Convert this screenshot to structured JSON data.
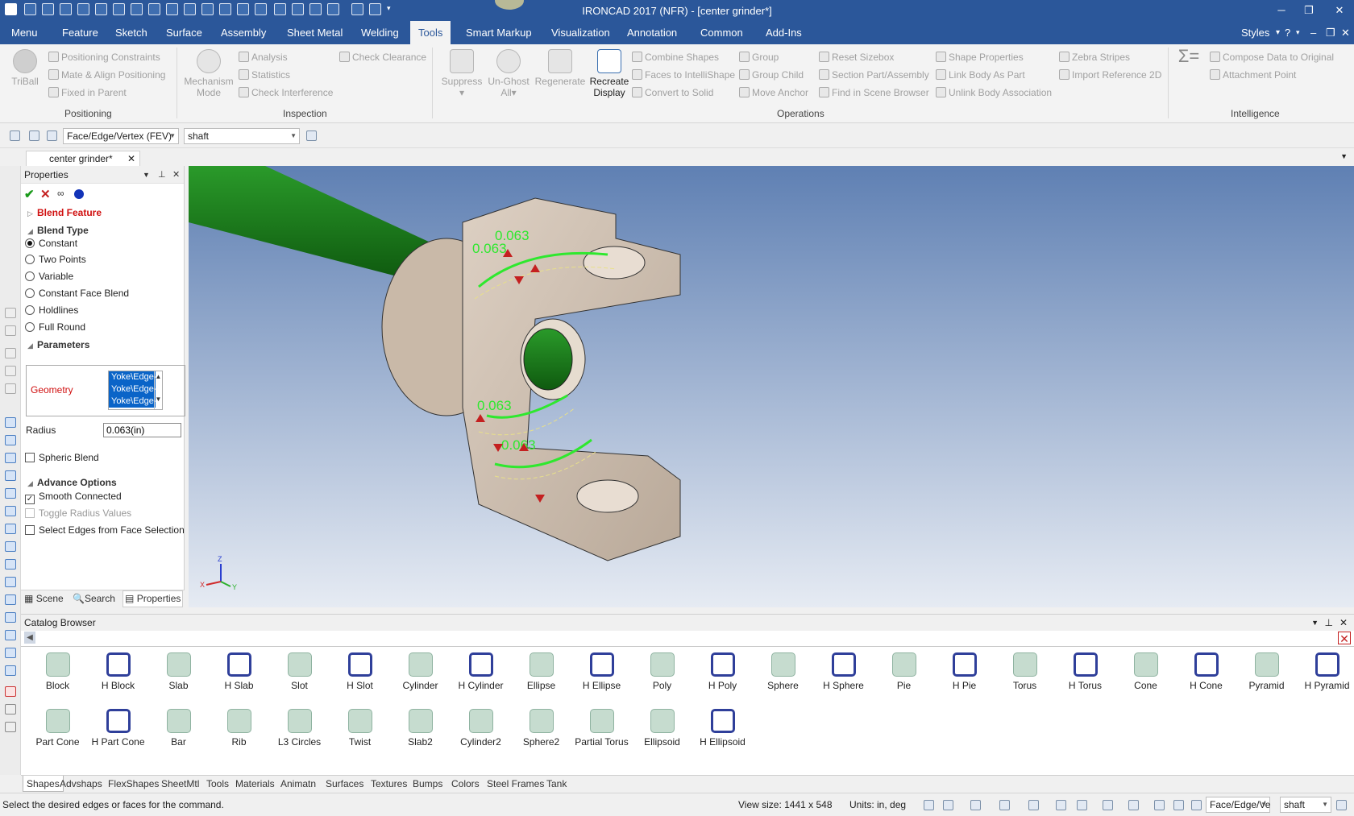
{
  "app": {
    "title": "IRONCAD 2017 (NFR) - [center grinder*]"
  },
  "menubar": {
    "tabs": [
      "Menu",
      "Feature",
      "Sketch",
      "Surface",
      "Assembly",
      "Sheet Metal",
      "Welding",
      "Tools",
      "Smart Markup",
      "Visualization",
      "Annotation",
      "Common",
      "Add-Ins"
    ],
    "active": "Tools",
    "styles_label": "Styles"
  },
  "ribbon": {
    "triball": "TriBall",
    "positioning": [
      "Positioning Constraints",
      "Mate & Align Positioning",
      "Fixed in Parent"
    ],
    "positioning_label": "Positioning",
    "mechanism": [
      "Mechanism",
      "Mode"
    ],
    "inspection": [
      "Analysis",
      "Statistics",
      "Check Interference",
      "Check Clearance"
    ],
    "inspection_label": "Inspection",
    "suppress": "Suppress",
    "unghost": [
      "Un-Ghost",
      "All"
    ],
    "regenerate": "Regenerate",
    "recreate": [
      "Recreate",
      "Display"
    ],
    "ops_col1": [
      "Combine Shapes",
      "Faces to IntelliShape",
      "Convert to Solid"
    ],
    "ops_col2": [
      "Group",
      "Group Child",
      "Move Anchor"
    ],
    "ops_col3": [
      "Reset Sizebox",
      "Section Part/Assembly",
      "Find in Scene Browser"
    ],
    "ops_col4": [
      "Shape Properties",
      "Link Body As Part",
      "Unlink Body Association"
    ],
    "ops_col5": [
      "Zebra Stripes",
      "Import Reference 2D"
    ],
    "operations_label": "Operations",
    "intel": [
      "Compose Data to Original",
      "Attachment Point"
    ],
    "intelligence_label": "Intelligence"
  },
  "selection": {
    "filter": "Face/Edge/Vertex (FEV)",
    "part": "shaft"
  },
  "doc_tab": "center grinder*",
  "properties": {
    "title": "Properties",
    "blend_feature": "Blend Feature",
    "blend_type": "Blend Type",
    "blend_options": [
      "Constant",
      "Two Points",
      "Variable",
      "Constant Face Blend",
      "Holdlines",
      "Full Round"
    ],
    "selected_option": "Constant",
    "parameters": "Parameters",
    "geometry_label": "Geometry",
    "geometry_items": [
      "Yoke\\Edge-",
      "Yoke\\Edge-",
      "Yoke\\Edge-"
    ],
    "radius_label": "Radius",
    "radius_value": "0.063(in)",
    "spheric_blend": "Spheric Blend",
    "advance_options": "Advance Options",
    "smooth_connected": "Smooth Connected",
    "toggle_radius": "Toggle Radius Values",
    "select_edges": "Select Edges from Face Selection",
    "tabs": [
      "Scene",
      "Search",
      "Properties"
    ]
  },
  "viewport": {
    "dimension_labels": [
      "0.063",
      "0.063",
      "0.063",
      "0.063"
    ],
    "axis": [
      "Z",
      "X",
      "Y"
    ]
  },
  "catalog": {
    "title": "Catalog Browser",
    "shapes_row1": [
      "Block",
      "H Block",
      "Slab",
      "H Slab",
      "Slot",
      "H Slot",
      "Cylinder",
      "H Cylinder",
      "Ellipse",
      "H Ellipse",
      "Poly",
      "H Poly",
      "Sphere",
      "H Sphere",
      "Pie",
      "H Pie",
      "Torus",
      "H Torus",
      "Cone",
      "H Cone",
      "Pyramid",
      "H Pyramid"
    ],
    "shapes_row2": [
      "Part Cone",
      "H Part Cone",
      "Bar",
      "Rib",
      "L3 Circles",
      "Twist",
      "Slab2",
      "Cylinder2",
      "Sphere2",
      "Partial Torus",
      "Ellipsoid",
      "H Ellipsoid"
    ],
    "tabs": [
      "Shapes",
      "Advshaps",
      "FlexShapes",
      "SheetMtl",
      "Tools",
      "Materials",
      "Animatn",
      "Surfaces",
      "Textures",
      "Bumps",
      "Colors",
      "Steel Frames",
      "Tank"
    ]
  },
  "status": {
    "message": "Select the desired edges or faces for the command.",
    "view_size": "View size: 1441 x 548",
    "units": "Units: in, deg",
    "filter_short": "Face/Edge/Ve",
    "part": "shaft"
  },
  "colors": {
    "title_blue": "#2b579a",
    "part_tan": "#c9b9a8",
    "shaft_green": "#1f7a1f",
    "blend_green": "#2ee82e",
    "sky_top": "#6a8ab8",
    "sky_bottom": "#e3e9f2"
  }
}
